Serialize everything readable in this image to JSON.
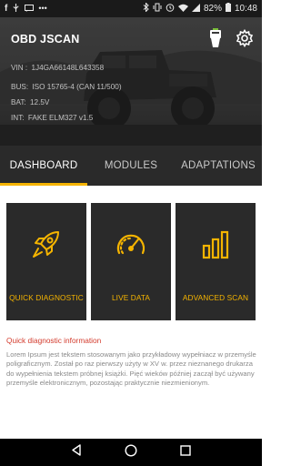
{
  "status_bar": {
    "left_icons": [
      "facebook-icon",
      "usb-icon",
      "message-icon",
      "more-icon"
    ],
    "battery_percent": "82%",
    "time": "10:48"
  },
  "header": {
    "title": "OBD JSCAN",
    "info": [
      {
        "label": "VIN :",
        "value": "1J4GA66148L643358"
      },
      {
        "label": "BUS:",
        "value": "ISO 15765-4 (CAN 11/500)"
      },
      {
        "label": "BAT:",
        "value": "12.5V"
      },
      {
        "label": "INT:",
        "value": "FAKE ELM327 v1.5"
      }
    ]
  },
  "tabs": [
    {
      "label": "DASHBOARD",
      "active": true
    },
    {
      "label": "MODULES",
      "active": false
    },
    {
      "label": "ADAPTATIONS",
      "active": false
    }
  ],
  "tiles": [
    {
      "label": "QUICK DIAGNOSTIC",
      "icon": "rocket-icon"
    },
    {
      "label": "LIVE DATA",
      "icon": "speedometer-icon"
    },
    {
      "label": "ADVANCED SCAN",
      "icon": "bar-chart-icon"
    }
  ],
  "section": {
    "title": "Quick diagnostic information",
    "body": "Lorem Ipsum jest tekstem stosowanym jako przykładowy wypełniacz w przemyśle poligraficznym. Został po raz pierwszy użyty w XV w. przez nieznanego drukarza do wypełnienia tekstem próbnej książki. Pięć wieków później zaczął być używany przemyśle elektronicznym, pozostając praktycznie niezmienionym."
  },
  "colors": {
    "accent": "#f5b400",
    "dark": "#2a2a2a",
    "section_title": "#d33a2c"
  }
}
